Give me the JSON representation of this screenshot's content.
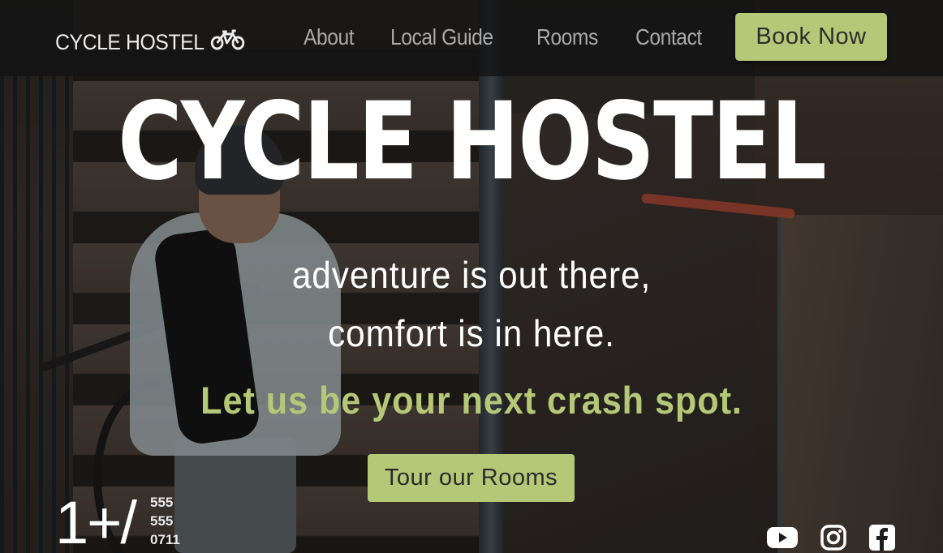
{
  "nav": {
    "brand": "CYCLE HOSTEL",
    "brand_icon": "bicycle-icon",
    "links": [
      "About",
      "Local Guide",
      "Rooms",
      "Contact"
    ],
    "cta": "Book Now"
  },
  "hero": {
    "title": "CYCLE HOSTEL",
    "tagline_line1": "adventure is out there,",
    "tagline_line2": "comfort is in here.",
    "crash_line": "Let us be your next crash spot.",
    "cta": "Tour our Rooms"
  },
  "phone": {
    "prefix": "1+/",
    "digits": [
      "555",
      "555",
      "0711"
    ]
  },
  "social": [
    "youtube-icon",
    "instagram-icon",
    "facebook-icon"
  ],
  "colors": {
    "accent": "#b5c878",
    "nav_bg": "#141414",
    "nav_link": "#a9a9a9"
  }
}
